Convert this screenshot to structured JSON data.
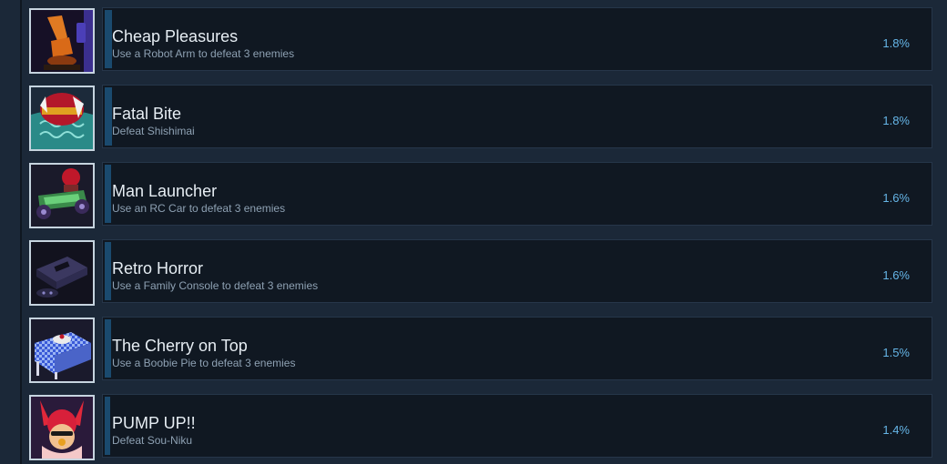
{
  "achievements": [
    {
      "name": "Cheap Pleasures",
      "description": "Use a Robot Arm to defeat 3 enemies",
      "percent": "1.8%",
      "icon": "robot-arm-icon",
      "fill_fraction": 0.018
    },
    {
      "name": "Fatal Bite",
      "description": "Defeat Shishimai",
      "percent": "1.8%",
      "icon": "shishimai-mask-icon",
      "fill_fraction": 0.018
    },
    {
      "name": "Man Launcher",
      "description": "Use an RC Car to defeat 3 enemies",
      "percent": "1.6%",
      "icon": "rc-car-icon",
      "fill_fraction": 0.016
    },
    {
      "name": "Retro Horror",
      "description": "Use a Family Console to defeat 3 enemies",
      "percent": "1.6%",
      "icon": "game-console-icon",
      "fill_fraction": 0.016
    },
    {
      "name": "The Cherry on Top",
      "description": "Use a Boobie Pie to defeat 3 enemies",
      "percent": "1.5%",
      "icon": "pie-table-icon",
      "fill_fraction": 0.015
    },
    {
      "name": "PUMP UP!!",
      "description": "Defeat Sou-Niku",
      "percent": "1.4%",
      "icon": "sou-niku-icon",
      "fill_fraction": 0.014
    }
  ],
  "colors": {
    "background": "#1b2838",
    "card": "#101822",
    "progress_fill": "#1a4a6e",
    "title": "#e6edf3",
    "description": "#8ea1b3",
    "percent": "#66b6e8"
  }
}
